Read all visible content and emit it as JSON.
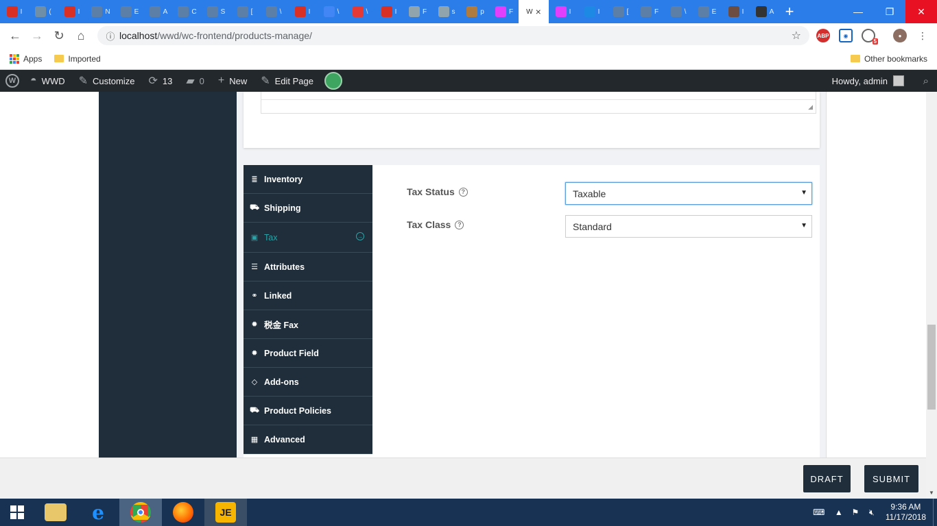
{
  "browser": {
    "tabs": [
      {
        "icon": "gmail-icon",
        "text": "I",
        "color": "#d93025"
      },
      {
        "icon": "site-icon",
        "text": "(",
        "color": "#6f8ea8"
      },
      {
        "icon": "gmail-icon",
        "text": "I",
        "color": "#d93025"
      },
      {
        "icon": "wp-plugin-icon",
        "text": "N",
        "color": "#5b7fa6"
      },
      {
        "icon": "wp-plugin-icon",
        "text": "E",
        "color": "#5b7fa6"
      },
      {
        "icon": "wp-plugin-icon",
        "text": "A",
        "color": "#5b7fa6"
      },
      {
        "icon": "wp-plugin-icon",
        "text": "C",
        "color": "#5b7fa6"
      },
      {
        "icon": "wp-plugin-icon",
        "text": "S",
        "color": "#5b7fa6"
      },
      {
        "icon": "wp-plugin-icon",
        "text": "[",
        "color": "#5b7fa6"
      },
      {
        "icon": "wp-plugin-icon",
        "text": "\\",
        "color": "#5b7fa6"
      },
      {
        "icon": "gmail-icon",
        "text": "I",
        "color": "#d93025"
      },
      {
        "icon": "docs-icon",
        "text": "\\",
        "color": "#4285f4"
      },
      {
        "icon": "off-icon",
        "text": "\\",
        "color": "#e53935"
      },
      {
        "icon": "gmail-icon",
        "text": "I",
        "color": "#d93025"
      },
      {
        "icon": "file-icon",
        "text": "F",
        "color": "#90a4ae"
      },
      {
        "icon": "file-icon",
        "text": "s",
        "color": "#90a4ae"
      },
      {
        "icon": "bridge-icon",
        "text": "p",
        "color": "#b07b3e"
      },
      {
        "icon": "circle-icon",
        "text": "F",
        "color": "#e040fb"
      }
    ],
    "active_tab": {
      "text": "W",
      "close": "×"
    },
    "tabs_after": [
      {
        "icon": "circle-icon",
        "text": "I",
        "color": "#e040fb"
      },
      {
        "icon": "ibb-icon",
        "text": "I",
        "color": "#1e88e5"
      },
      {
        "icon": "wp-plugin-icon",
        "text": "[",
        "color": "#5b7fa6"
      },
      {
        "icon": "wp-plugin-icon",
        "text": "F",
        "color": "#5b7fa6"
      },
      {
        "icon": "wp-plugin-icon",
        "text": "\\",
        "color": "#5b7fa6"
      },
      {
        "icon": "wp-plugin-icon",
        "text": "E",
        "color": "#5b7fa6"
      },
      {
        "icon": "pattern-icon",
        "text": "I",
        "color": "#6d4c41"
      },
      {
        "icon": "w-icon",
        "text": "A",
        "color": "#333333"
      }
    ],
    "new_tab": "+",
    "url_host": "localhost",
    "url_path": "/wwd/wc-frontend/products-manage/",
    "ext_abp": "ABP",
    "ext_badge": "5"
  },
  "bookmarks": {
    "apps": "Apps",
    "imported": "Imported",
    "other": "Other bookmarks"
  },
  "wpbar": {
    "site": "WWD",
    "customize": "Customize",
    "updates": "13",
    "comments": "0",
    "new": "New",
    "edit_page": "Edit Page",
    "howdy": "Howdy, admin"
  },
  "menu": {
    "items": [
      {
        "label": "Inventory",
        "icon": "database-icon"
      },
      {
        "label": "Shipping",
        "icon": "truck-icon"
      },
      {
        "label": "Tax",
        "icon": "money-icon",
        "active": true
      },
      {
        "label": "Attributes",
        "icon": "list-icon"
      },
      {
        "label": "Linked",
        "icon": "link-icon"
      },
      {
        "label": "税金 Fax",
        "icon": "badge-icon"
      },
      {
        "label": "Product Field",
        "icon": "badge-icon"
      },
      {
        "label": "Add-ons",
        "icon": "diamond-icon"
      },
      {
        "label": "Product Policies",
        "icon": "ambulance-icon"
      },
      {
        "label": "Advanced",
        "icon": "grid-icon"
      }
    ]
  },
  "tax": {
    "status_label": "Tax Status",
    "status_value": "Taxable",
    "class_label": "Tax Class",
    "class_value": "Standard"
  },
  "footer": {
    "draft": "DRAFT",
    "submit": "SUBMIT"
  },
  "taskbar": {
    "time": "9:36 AM",
    "date": "11/17/2018"
  },
  "colors": {
    "accent_teal": "#2aa3a8",
    "sidebar_dark": "#1f2e3a",
    "wp_admin_bar": "#23282d",
    "tab_strip": "#2b7de9"
  }
}
